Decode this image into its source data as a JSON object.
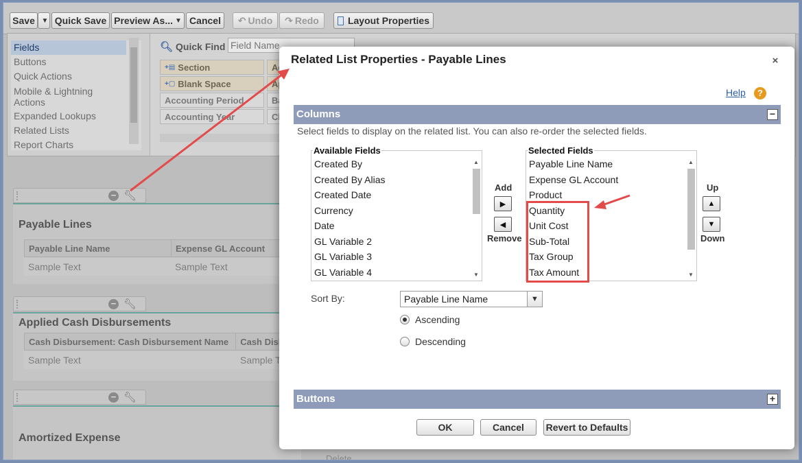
{
  "toolbar": {
    "save": "Save",
    "save_menu": "▼",
    "quick_save": "Quick Save",
    "preview_as": "Preview As...",
    "preview_menu": "▼",
    "cancel": "Cancel",
    "undo": "Undo",
    "redo": "Redo",
    "layout_properties": "Layout Properties"
  },
  "palette": {
    "nav": [
      "Fields",
      "Buttons",
      "Quick Actions",
      "Mobile & Lightning Actions",
      "Expanded Lookups",
      "Related Lists",
      "Report Charts"
    ],
    "quick_find_label": "Quick Find",
    "quick_find_placeholder": "Field Name",
    "chips": [
      "Section",
      "Blank Space",
      "Accounting Period",
      "Accounting Year",
      "Ag",
      "Ap",
      "Bal",
      "Clo"
    ]
  },
  "sections": [
    {
      "title": "Payable Lines",
      "columns": [
        "Payable Line Name",
        "Expense GL Account"
      ],
      "sample": [
        "Sample Text",
        "Sample Text"
      ]
    },
    {
      "title": "Applied Cash Disbursements",
      "columns": [
        "Cash Disbursement: Cash Disbursement Name",
        "Cash Disb"
      ],
      "sample": [
        "Sample Text",
        "Sample T"
      ]
    },
    {
      "title": "Amortized Expense",
      "extra": "Delete"
    }
  ],
  "modal": {
    "title": "Related List Properties - Payable Lines",
    "close": "×",
    "help": "Help",
    "help_icon": "?",
    "columns_bar": "Columns",
    "columns_desc": "Select fields to display on the related list. You can also re-order the selected fields.",
    "available_label": "Available Fields",
    "available_fields": [
      "Created By",
      "Created By Alias",
      "Created Date",
      "Currency",
      "Date",
      "GL Variable 2",
      "GL Variable 3",
      "GL Variable 4"
    ],
    "selected_label": "Selected Fields",
    "selected_fields": [
      "Payable Line Name",
      "Expense GL Account",
      "Product",
      "Quantity",
      "Unit Cost",
      "Sub-Total",
      "Tax Group",
      "Tax Amount"
    ],
    "add_label": "Add",
    "remove_label": "Remove",
    "up_label": "Up",
    "down_label": "Down",
    "sort_by_label": "Sort By:",
    "sort_by_value": "Payable Line Name",
    "ascending": "Ascending",
    "descending": "Descending",
    "buttons_bar": "Buttons",
    "ok": "OK",
    "cancel": "Cancel",
    "revert": "Revert to Defaults"
  },
  "colors": {
    "section_bar": "#8e9cba",
    "annotation_red": "#e34a4a",
    "help_icon": "#e89a1f"
  }
}
